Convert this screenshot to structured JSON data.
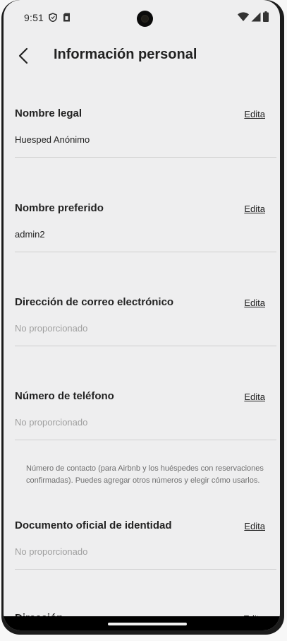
{
  "status_bar": {
    "time": "9:51",
    "icons": [
      "shield-icon",
      "sim-card-icon",
      "wifi-icon",
      "cellular-signal-icon",
      "battery-icon"
    ]
  },
  "header": {
    "back_icon": "back-arrow-icon",
    "title": "Información personal"
  },
  "sections": [
    {
      "title": "Nombre legal",
      "edit_label": "Edita",
      "value": "Huesped Anónimo",
      "muted": false
    },
    {
      "title": "Nombre preferido",
      "edit_label": "Edita",
      "value": "admin2",
      "muted": false
    },
    {
      "title": "Dirección de correo electrónico",
      "edit_label": "Edita",
      "value": "No proporcionado",
      "muted": true
    },
    {
      "title": "Número de teléfono",
      "edit_label": "Edita",
      "value": "No proporcionado",
      "muted": true
    },
    {
      "title": "Documento oficial de identidad",
      "edit_label": "Edita",
      "value": "No proporcionado",
      "muted": true
    }
  ],
  "phone_note": "Número de contacto (para Airbnb y los huéspedes con reservaciones confirmadas). Puedes agregar otros números y elegir cómo usarlos.",
  "cut_section": {
    "title": "Dirección",
    "edit_label": "Edita"
  },
  "colors": {
    "background": "#eeeeef",
    "text": "#222222",
    "muted_text": "#a0a0a0",
    "divider": "#cfcfcf"
  }
}
